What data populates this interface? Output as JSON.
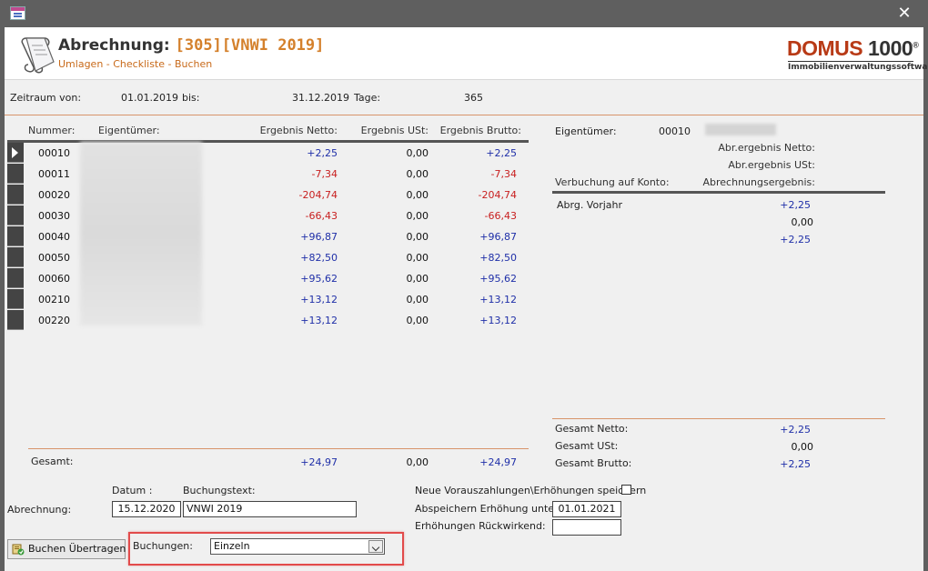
{
  "window": {
    "close_symbol": "✕"
  },
  "header": {
    "title_prefix": "Abrechnung:",
    "title_code": "[305][VNWI 2019]",
    "subtitle": "Umlagen - Checkliste - Buchen",
    "logo_main": "DOMUS",
    "logo_num": "1000",
    "logo_reg": "®",
    "logo_sub": "Immobilienverwaltungssoftware"
  },
  "period": {
    "from_label": "Zeitraum von:",
    "from_value": "01.01.2019",
    "to_label": "bis:",
    "to_value": "31.12.2019",
    "days_label": "Tage:",
    "days_value": "365"
  },
  "table": {
    "headers": {
      "nummer": "Nummer:",
      "eigentuemer": "Eigentümer:",
      "netto": "Ergebnis Netto:",
      "ust": "Ergebnis USt:",
      "brutto": "Ergebnis Brutto:"
    },
    "rows": [
      {
        "nr": "00010",
        "netto": "+2,25",
        "ust": "0,00",
        "brutto": "+2,25",
        "sign": "pos"
      },
      {
        "nr": "00011",
        "netto": "-7,34",
        "ust": "0,00",
        "brutto": "-7,34",
        "sign": "neg"
      },
      {
        "nr": "00020",
        "netto": "-204,74",
        "ust": "0,00",
        "brutto": "-204,74",
        "sign": "neg"
      },
      {
        "nr": "00030",
        "netto": "-66,43",
        "ust": "0,00",
        "brutto": "-66,43",
        "sign": "neg"
      },
      {
        "nr": "00040",
        "netto": "+96,87",
        "ust": "0,00",
        "brutto": "+96,87",
        "sign": "pos"
      },
      {
        "nr": "00050",
        "netto": "+82,50",
        "ust": "0,00",
        "brutto": "+82,50",
        "sign": "pos"
      },
      {
        "nr": "00060",
        "netto": "+95,62",
        "ust": "0,00",
        "brutto": "+95,62",
        "sign": "pos"
      },
      {
        "nr": "00210",
        "netto": "+13,12",
        "ust": "0,00",
        "brutto": "+13,12",
        "sign": "pos"
      },
      {
        "nr": "00220",
        "netto": "+13,12",
        "ust": "0,00",
        "brutto": "+13,12",
        "sign": "pos"
      }
    ],
    "total_label": "Gesamt:",
    "total_netto": "+24,97",
    "total_ust": "0,00",
    "total_brutto": "+24,97"
  },
  "detail": {
    "owner_label": "Eigentümer:",
    "owner_nr": "00010",
    "abr_netto_label": "Abr.ergebnis Netto:",
    "abr_ust_label": "Abr.ergebnis USt:",
    "konto_label": "Verbuchung auf Konto:",
    "result_label": "Abrechnungsergebnis:",
    "entry_label": "Abrg. Vorjahr",
    "entry_value": "+2,25",
    "val2": "0,00",
    "val3": "+2,25",
    "sum_netto_label": "Gesamt Netto:",
    "sum_netto": "+2,25",
    "sum_ust_label": "Gesamt USt:",
    "sum_ust": "0,00",
    "sum_brutto_label": "Gesamt Brutto:",
    "sum_brutto": "+2,25"
  },
  "booking": {
    "datum_label": "Datum :",
    "text_label": "Buchungstext:",
    "abrechnung_label": "Abrechnung:",
    "datum_value": "15.12.2020",
    "text_value": "VNWI 2019",
    "neue_label": "Neue Vorauszahlungen\\Erhöhungen speichern",
    "speichern_label": "Abspeichern Erhöhung unter:",
    "speichern_value": "01.01.2021",
    "rueck_label": "Erhöhungen Rückwirkend:",
    "rueck_value": "",
    "buchen_button": "Buchen Übertragen",
    "buchungen_label": "Buchungen:",
    "buchungen_value": "Einzeln"
  },
  "colors": {
    "positive": "#1f2fa8",
    "negative": "#c81e1e",
    "accent": "#d4802b",
    "highlight": "#e24b4b"
  }
}
